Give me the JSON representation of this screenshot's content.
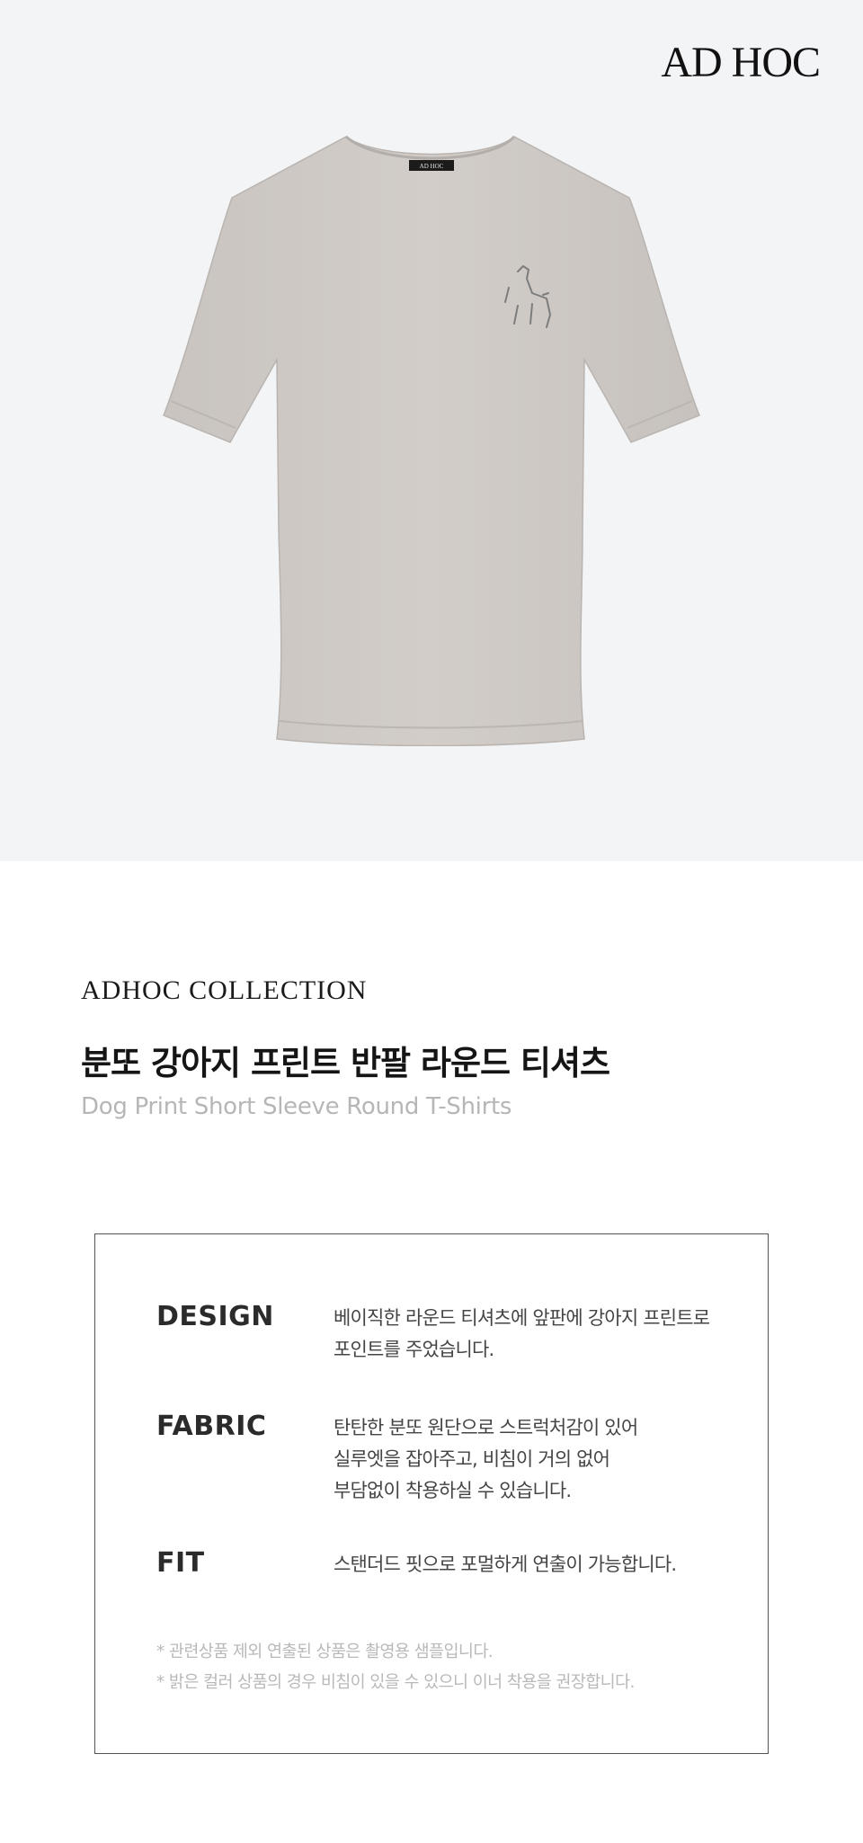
{
  "brand": {
    "logo_text": "AD HOC"
  },
  "product": {
    "collection": "ADHOC  COLLECTION",
    "name_kr": "분또 강아지 프린트 반팔 라운드 티셔츠",
    "name_en": "Dog Print Short Sleeve Round T-Shirts",
    "image_label": "AD HOC",
    "colors": {
      "shirt": "#cfcac6",
      "background": "#f3f4f6"
    }
  },
  "details": {
    "design": {
      "label": "DESIGN",
      "lines": [
        "베이직한 라운드 티셔츠에 앞판에 강아지 프린트로",
        "포인트를 주었습니다."
      ]
    },
    "fabric": {
      "label": "FABRIC",
      "lines": [
        "탄탄한 분또 원단으로 스트럭처감이 있어",
        "실루엣을 잡아주고, 비침이 거의 없어",
        "부담없이 착용하실 수 있습니다."
      ]
    },
    "fit": {
      "label": "FIT",
      "lines": [
        "스탠더드 핏으로 포멀하게 연출이 가능합니다."
      ]
    },
    "notes": [
      "* 관련상품 제외 연출된 상품은 촬영용 샘플입니다.",
      "* 밝은 컬러 상품의 경우 비침이 있을 수 있으니 이너 착용을 권장합니다."
    ]
  }
}
